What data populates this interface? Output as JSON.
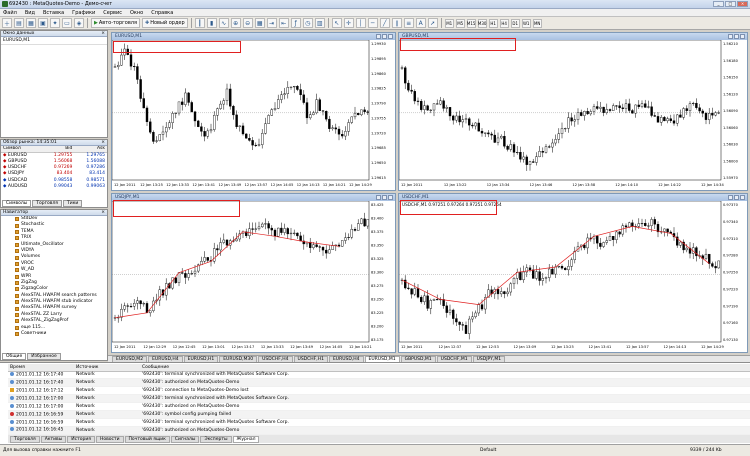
{
  "window": {
    "title": "692430 : MetaQuotes-Demo - Демо-счет"
  },
  "menu": [
    "Файл",
    "Вид",
    "Вставка",
    "Графики",
    "Сервис",
    "Окно",
    "Справка"
  ],
  "toolbar": {
    "autotrade": "Авто-торговля",
    "new_order": "Новый ордер",
    "timeframes": [
      "M1",
      "M5",
      "M15",
      "M30",
      "H1",
      "H4",
      "D1",
      "W1",
      "MN"
    ]
  },
  "data_window": {
    "title": "Окно данных",
    "symbol": "EURUSD,M1"
  },
  "market_watch": {
    "title": "Обзор рынка: 14:35:01",
    "columns": [
      "Символ",
      "Bid",
      "Ask"
    ],
    "rows": [
      {
        "symbol": "EURUSD",
        "bid": "1.29755",
        "ask": "1.29765"
      },
      {
        "symbol": "GBPUSD",
        "bid": "1.56068",
        "ask": "1.56088"
      },
      {
        "symbol": "USDCHF",
        "bid": "0.97269",
        "ask": "0.97286"
      },
      {
        "symbol": "USDJPY",
        "bid": "83.404",
        "ask": "83.414"
      },
      {
        "symbol": "USDCAD",
        "bid": "0.98558",
        "ask": "0.98571"
      },
      {
        "symbol": "AUDUSD",
        "bid": "0.99043",
        "ask": "0.99063"
      }
    ],
    "tabs": [
      "Символы",
      "Торговля",
      "Тики"
    ]
  },
  "navigator": {
    "title": "Навигатор",
    "items": [
      "StdDev",
      "Stochastic",
      "TEMA",
      "TRIX",
      "Ultimate_Oscillator",
      "VIDYA",
      "Volumes",
      "VROC",
      "W_AD",
      "WPR",
      "ZigZag",
      "ZigzagColor",
      "AlexSTAL HWAFM search patterns",
      "AlexSTAL HWAFM stub indicator",
      "AlexSTAL HWAFM survey",
      "AlexSTAL ZZ Larry",
      "AlexSTAL_ZigZagProf",
      "еще 115...",
      "Советники"
    ],
    "tabs": [
      "Общие",
      "Избранное"
    ]
  },
  "charts": [
    {
      "title": "EURUSD,M1",
      "y_ticks": [
        "1.29930",
        "1.29895",
        "1.29860",
        "1.29825",
        "1.29790",
        "1.29755",
        "1.29720",
        "1.29685",
        "1.29650",
        "1.29615"
      ],
      "x_ticks": [
        "12 Jan 2011",
        "12 Jan 13:25",
        "12 Jan 13:33",
        "12 Jan 13:41",
        "12 Jan 13:49",
        "12 Jan 13:57",
        "12 Jan 14:05",
        "12 Jan 14:13",
        "12 Jan 14:21",
        "12 Jan 14:29"
      ]
    },
    {
      "title": "GBPUSD,M1",
      "y_ticks": [
        "1.56210",
        "1.56180",
        "1.56150",
        "1.56120",
        "1.56090",
        "1.56060",
        "1.56030",
        "1.56000",
        "1.55970"
      ],
      "x_ticks": [
        "12 Jan 2011",
        "12 Jan 13:22",
        "12 Jan 13:34",
        "12 Jan 13:46",
        "12 Jan 13:58",
        "12 Jan 14:10",
        "12 Jan 14:22",
        "12 Jan 14:34"
      ]
    },
    {
      "title": "USDJPY,M1",
      "y_ticks": [
        "83.425",
        "83.400",
        "83.375",
        "83.350",
        "83.325",
        "83.300",
        "83.275",
        "83.250",
        "83.225",
        "83.200",
        "83.175"
      ],
      "x_ticks": [
        "12 Jan 2011",
        "12 Jan 12:29",
        "12 Jan 12:45",
        "12 Jan 13:01",
        "12 Jan 13:17",
        "12 Jan 13:33",
        "12 Jan 13:49",
        "12 Jan 14:05",
        "12 Jan 14:21"
      ]
    },
    {
      "title": "USDCHF,M1",
      "header_values": "USDCHF,M1  0.97251 0.97264 0.97251 0.97264",
      "y_ticks": [
        "0.97370",
        "0.97340",
        "0.97310",
        "0.97280",
        "0.97250",
        "0.97220",
        "0.97190",
        "0.97160",
        "0.97130"
      ],
      "x_ticks": [
        "12 Jan 2011",
        "12 Jan 12:37",
        "12 Jan 12:53",
        "12 Jan 13:09",
        "12 Jan 13:25",
        "12 Jan 13:41",
        "12 Jan 13:57",
        "12 Jan 14:13",
        "12 Jan 14:29"
      ]
    }
  ],
  "chart_tabs": [
    "EURUSD,M2",
    "EURUSD,H4",
    "EURUSD,H1",
    "EURUSD,M30",
    "USDCHF,H4",
    "USDCHF,H1",
    "EURUSD,H4",
    "EURUSD,M1",
    "GBPUSD,M1",
    "USDCHF,M1",
    "USDJPY,M1"
  ],
  "chart_tabs_active": 7,
  "terminal": {
    "columns": [
      "Время",
      "Источник",
      "Сообщение"
    ],
    "rows": [
      {
        "time": "2011.01.12 16:17:40",
        "source": "Network",
        "message": "'692430': terminal synchronized with MetaQuotes Software Corp."
      },
      {
        "time": "2011.01.12 16:17:40",
        "source": "Network",
        "message": "'692430': authorized on MetaQuotes-Demo"
      },
      {
        "time": "2011.01.12 16:17:12",
        "source": "Network",
        "message": "'692430': connection to MetaQuotes-Demo lost"
      },
      {
        "time": "2011.01.12 16:17:00",
        "source": "Network",
        "message": "'692430': terminal synchronized with MetaQuotes Software Corp."
      },
      {
        "time": "2011.01.12 16:17:00",
        "source": "Network",
        "message": "'692430': authorized on MetaQuotes-Demo"
      },
      {
        "time": "2011.01.12 16:16:59",
        "source": "Network",
        "message": "'692430': symbol config pumping failed"
      },
      {
        "time": "2011.01.12 16:16:59",
        "source": "Network",
        "message": "'692430': terminal synchronized with MetaQuotes Software Corp."
      },
      {
        "time": "2011.01.12 16:16:45",
        "source": "Network",
        "message": "'692430': authorized on MetaQuotes-Demo"
      }
    ],
    "tabs": [
      "Торговля",
      "Активы",
      "История",
      "Новости",
      "Почтовый ящик",
      "Сигналы",
      "Эксперты",
      "Журнал"
    ],
    "active_tab": 7
  },
  "status": {
    "help": "Для вызова справки нажмите F1",
    "profile": "Default",
    "traffic": "9339 / 244 Kb"
  }
}
